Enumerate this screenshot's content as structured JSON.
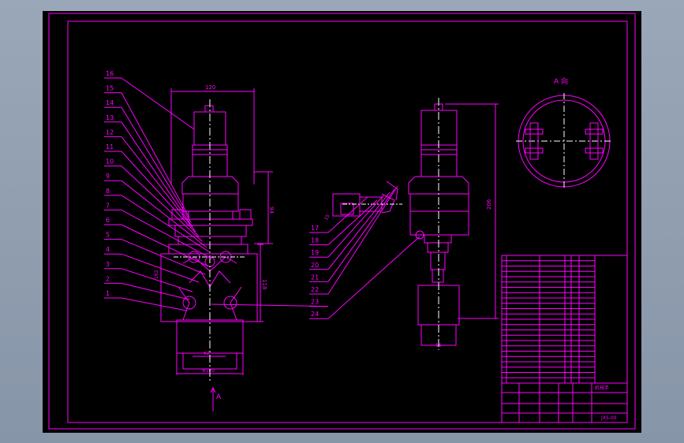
{
  "colors": {
    "background": "#000000",
    "line": "#ff00ff",
    "center": "#ffffff",
    "desktop": "#8f9cb0"
  },
  "drawing": {
    "view_title": "A 向",
    "view_arrow_label": "A",
    "part_numbers": [
      "16",
      "15",
      "14",
      "13",
      "12",
      "11",
      "10",
      "9",
      "8",
      "7",
      "6",
      "5",
      "4",
      "3",
      "2",
      "1"
    ],
    "part_numbers_right": [
      "17",
      "18",
      "19",
      "20",
      "21",
      "22",
      "23",
      "24"
    ],
    "dims": {
      "top_width": "120",
      "height_right": "94",
      "height_mid": "118",
      "left_small": "162",
      "bottom_inner": "62",
      "bottom_outer": "Φ100",
      "side_height": "206",
      "side_small": "15",
      "side_bottom": "56"
    },
    "title_block": {
      "title": "机械手",
      "drawing_no": "JXS-00"
    }
  }
}
